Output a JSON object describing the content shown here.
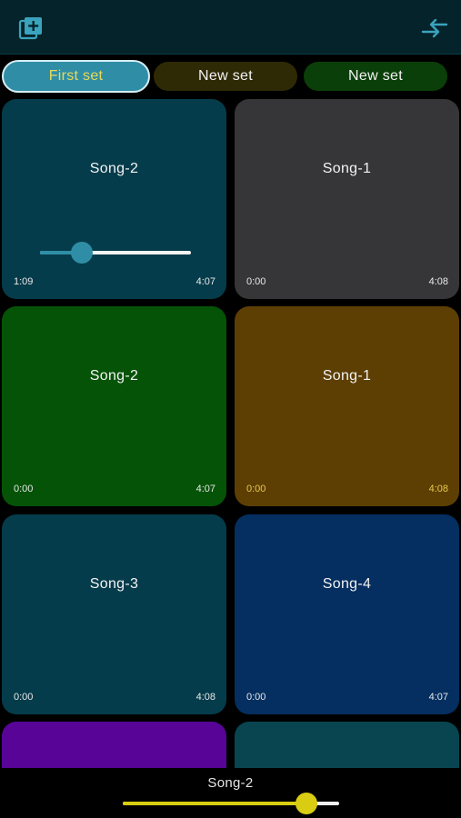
{
  "header": {
    "add_icon": "add-set-icon",
    "swap_icon": "swap-arrows-icon",
    "accent": "#2f8ea6"
  },
  "tabs": [
    {
      "label": "First set",
      "active": true
    },
    {
      "label": "New set",
      "active": false
    },
    {
      "label": "New set",
      "active": false
    }
  ],
  "tiles": [
    {
      "title": "Song-2",
      "elapsed": "1:09",
      "duration": "4:07",
      "color": "#053c4b",
      "progress": 0.28
    },
    {
      "title": "Song-1",
      "elapsed": "0:00",
      "duration": "4:08",
      "color": "#363638"
    },
    {
      "title": "Song-2",
      "elapsed": "0:00",
      "duration": "4:07",
      "color": "#055307"
    },
    {
      "title": "Song-1",
      "elapsed": "0:00",
      "duration": "4:08",
      "color": "#5d3f04"
    },
    {
      "title": "Song-3",
      "elapsed": "0:00",
      "duration": "4:08",
      "color": "#053c4b"
    },
    {
      "title": "Song-4",
      "elapsed": "0:00",
      "duration": "4:07",
      "color": "#042f60"
    },
    {
      "color": "#570497"
    },
    {
      "color": "#084551"
    }
  ],
  "player": {
    "now_playing": "Song-2",
    "volume": 0.85,
    "accent": "#d8cd12"
  }
}
